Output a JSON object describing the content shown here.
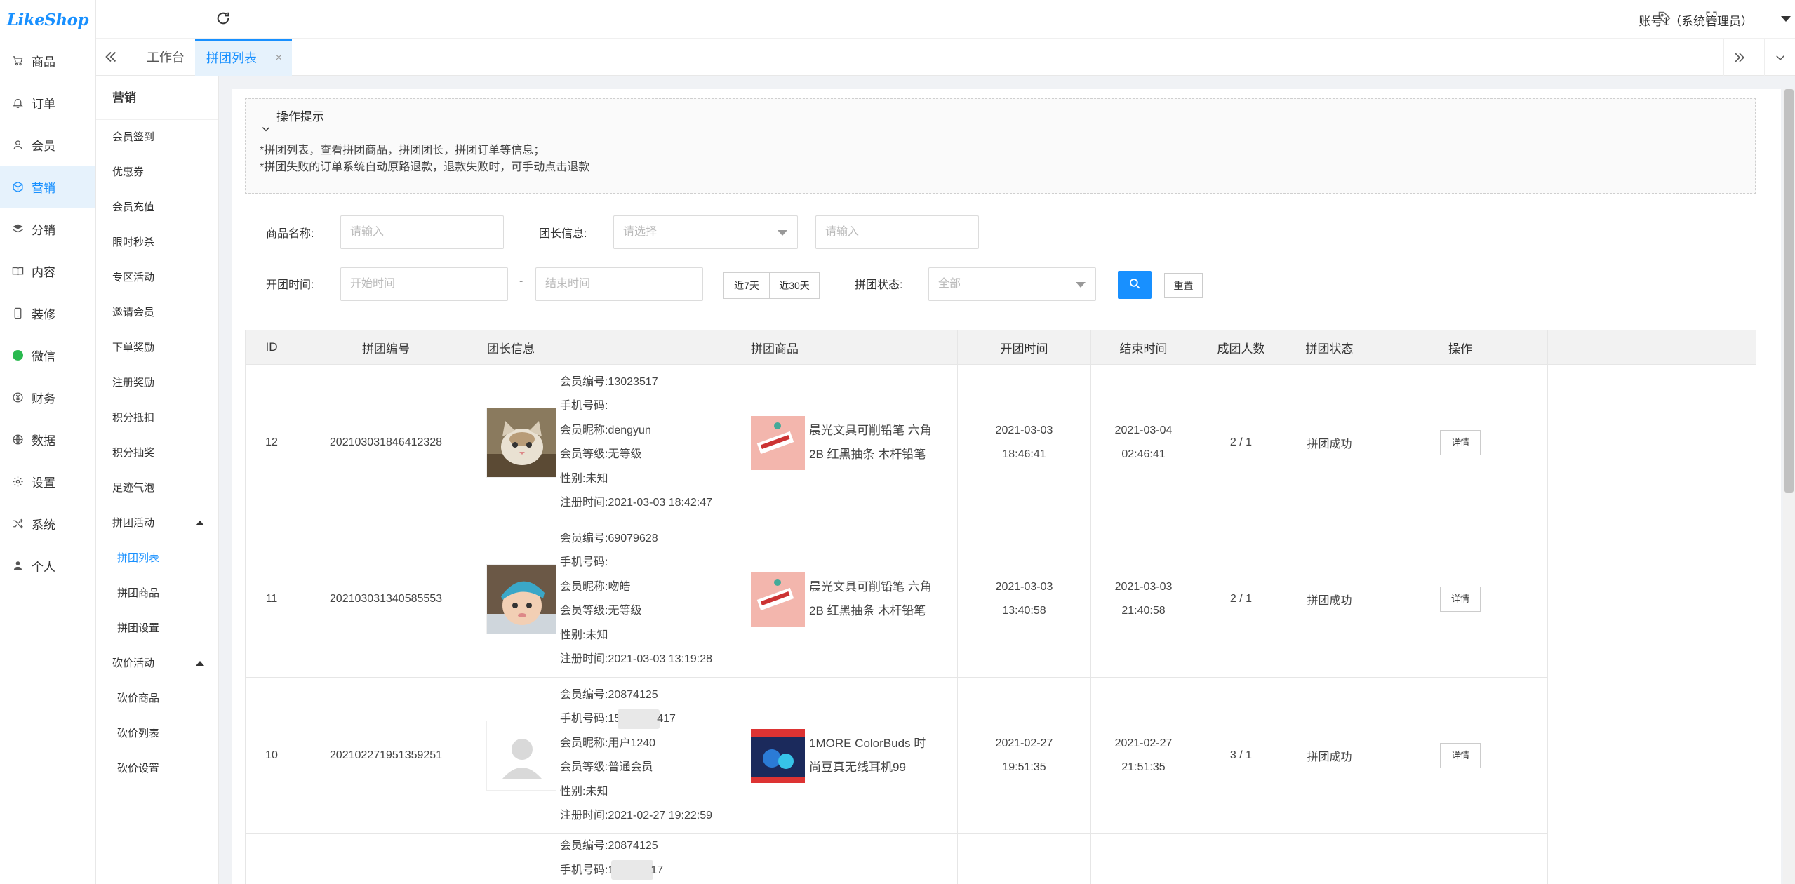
{
  "app": {
    "logo": "LikeShop"
  },
  "nav": {
    "items": [
      {
        "label": "商品",
        "icon": "cart-icon"
      },
      {
        "label": "订单",
        "icon": "bell-icon"
      },
      {
        "label": "会员",
        "icon": "user-icon"
      },
      {
        "label": "营销",
        "icon": "cube-icon",
        "active": true
      },
      {
        "label": "分销",
        "icon": "layers-icon"
      },
      {
        "label": "内容",
        "icon": "book-icon"
      },
      {
        "label": "装修",
        "icon": "phone-icon"
      },
      {
        "label": "微信",
        "icon": "wechat-icon"
      },
      {
        "label": "财务",
        "icon": "yen-icon"
      },
      {
        "label": "数据",
        "icon": "globe-icon"
      },
      {
        "label": "设置",
        "icon": "gear-icon"
      },
      {
        "label": "系统",
        "icon": "shuffle-icon"
      },
      {
        "label": "个人",
        "icon": "person-icon"
      }
    ]
  },
  "header": {
    "user": "账号1（系统管理员）"
  },
  "tabs": {
    "home": "工作台",
    "active": "拼团列表",
    "close": "×"
  },
  "subnav": {
    "title": "营销",
    "items": [
      "会员签到",
      "优惠券",
      "会员充值",
      "限时秒杀",
      "专区活动",
      "邀请会员",
      "下单奖励",
      "注册奖励",
      "积分抵扣",
      "积分抽奖",
      "足迹气泡"
    ],
    "group1": {
      "label": "拼团活动",
      "children": [
        "拼团列表",
        "拼团商品",
        "拼团设置"
      ]
    },
    "group2": {
      "label": "砍价活动",
      "children": [
        "砍价商品",
        "砍价列表",
        "砍价设置"
      ]
    }
  },
  "tips": {
    "title": "操作提示",
    "line1": "*拼团列表，查看拼团商品，拼团团长，拼团订单等信息；",
    "line2": "*拼团失败的订单系统自动原路退款，退款失败时，可手动点击退款"
  },
  "filters": {
    "goods_label": "商品名称:",
    "goods_placeholder": "请输入",
    "leader_label": "团长信息:",
    "leader_select_placeholder": "请选择",
    "leader_input_placeholder": "请输入",
    "time_label": "开团时间:",
    "start_placeholder": "开始时间",
    "dash": "-",
    "end_placeholder": "结束时间",
    "last7": "近7天",
    "last30": "近30天",
    "status_label": "拼团状态:",
    "status_value": "全部",
    "reset": "重置"
  },
  "table": {
    "headers": [
      "ID",
      "拼团编号",
      "团长信息",
      "拼团商品",
      "开团时间",
      "结束时间",
      "成团人数",
      "拼团状态",
      "操作"
    ],
    "rows": [
      {
        "id": "12",
        "no": "202103031846412328",
        "member_no": "会员编号:13023517",
        "phone": "手机号码:",
        "nickname": "会员昵称:dengyun",
        "level": "会员等级:无等级",
        "gender": "性别:未知",
        "reg": "注册时间:2021-03-03 18:42:47",
        "goods_line1": "晨光文具可削铅笔 六角",
        "goods_line2": "2B 红黑抽条 木杆铅笔",
        "start_date": "2021-03-03",
        "start_time": "18:46:41",
        "end_date": "2021-03-04",
        "end_time": "02:46:41",
        "people": "2 / 1",
        "status": "拼团成功",
        "action": "详情"
      },
      {
        "id": "11",
        "no": "202103031340585553",
        "member_no": "会员编号:69079628",
        "phone": "手机号码:",
        "nickname": "会员昵称:吻皓",
        "level": "会员等级:无等级",
        "gender": "性别:未知",
        "reg": "注册时间:2021-03-03 13:19:28",
        "goods_line1": "晨光文具可削铅笔 六角",
        "goods_line2": "2B 红黑抽条 木杆铅笔",
        "start_date": "2021-03-03",
        "start_time": "13:40:58",
        "end_date": "2021-03-03",
        "end_time": "21:40:58",
        "people": "2 / 1",
        "status": "拼团成功",
        "action": "详情"
      },
      {
        "id": "10",
        "no": "202102271951359251",
        "member_no": "会员编号:20874125",
        "phone_a": "手机号码:15",
        "phone_b": "417",
        "nickname": "会员昵称:用户1240",
        "level": "会员等级:普通会员",
        "gender": "性别:未知",
        "reg": "注册时间:2021-02-27 19:22:59",
        "goods_line1": "1MORE ColorBuds 时",
        "goods_line2": "尚豆真无线耳机99",
        "start_date": "2021-02-27",
        "start_time": "19:51:35",
        "end_date": "2021-02-27",
        "end_time": "21:51:35",
        "people": "3 / 1",
        "status": "拼团成功",
        "action": "详情"
      },
      {
        "member_no": "会员编号:20874125",
        "phone_a": "手机号码:1",
        "phone_b": "17"
      }
    ]
  }
}
